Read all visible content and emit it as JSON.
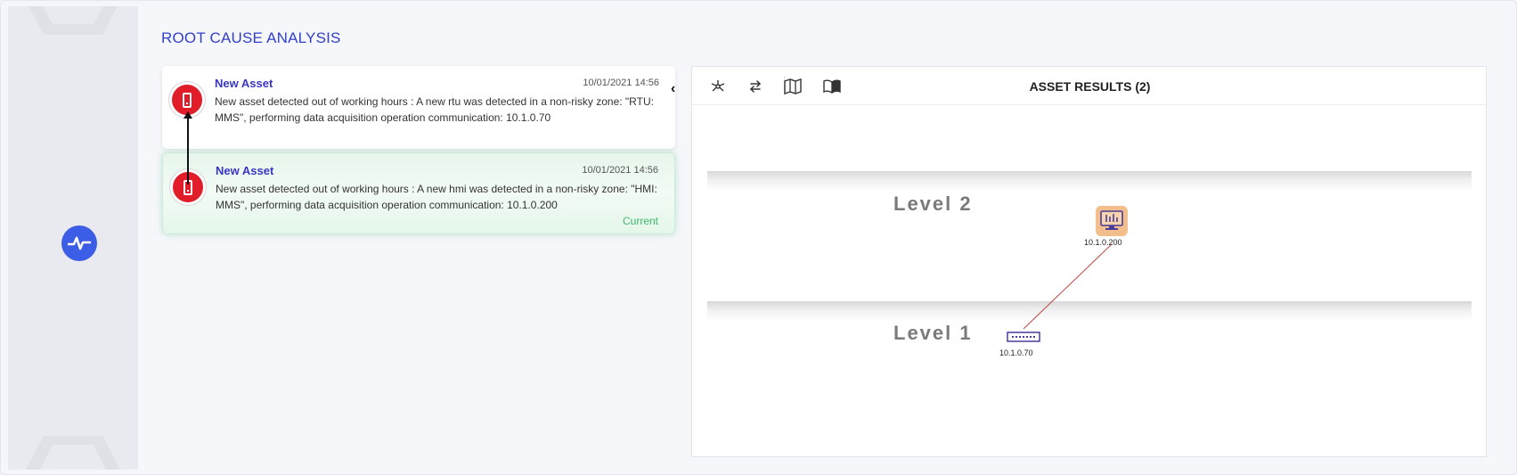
{
  "page": {
    "title": "ROOT CAUSE ANALYSIS"
  },
  "sidebar": {
    "icon": "activity-pulse-icon",
    "accent": "#3c5ee6"
  },
  "events": [
    {
      "title": "New Asset",
      "date": "10/01/2021 14:56",
      "text": "New asset detected out of working hours : A new rtu was detected in a non-risky zone: \"RTU: MMS\", performing data acquisition operation communication: 10.1.0.70",
      "icon": "rtu-device-icon",
      "status": ""
    },
    {
      "title": "New Asset",
      "date": "10/01/2021 14:56",
      "text": "New asset detected out of working hours : A new hmi was detected in a non-risky zone: \"HMI: MMS\", performing data acquisition operation communication: 10.1.0.200",
      "icon": "hmi-device-icon",
      "status": "Current"
    }
  ],
  "panel": {
    "title": "ASSET RESULTS (2)",
    "toolbar": [
      "network-topology-icon",
      "swap-arrows-icon",
      "map-icon",
      "book-icon"
    ]
  },
  "diagram": {
    "levels": [
      "Level 2",
      "Level 1"
    ],
    "nodes": [
      {
        "label": "10.1.0.200",
        "type": "hmi-icon"
      },
      {
        "label": "10.1.0.70",
        "type": "rtu-icon"
      }
    ],
    "link_color": "#c0504d"
  },
  "colors": {
    "event_alert": "#e11d2a",
    "current_text": "#3fba6a",
    "title": "#3240c8"
  }
}
